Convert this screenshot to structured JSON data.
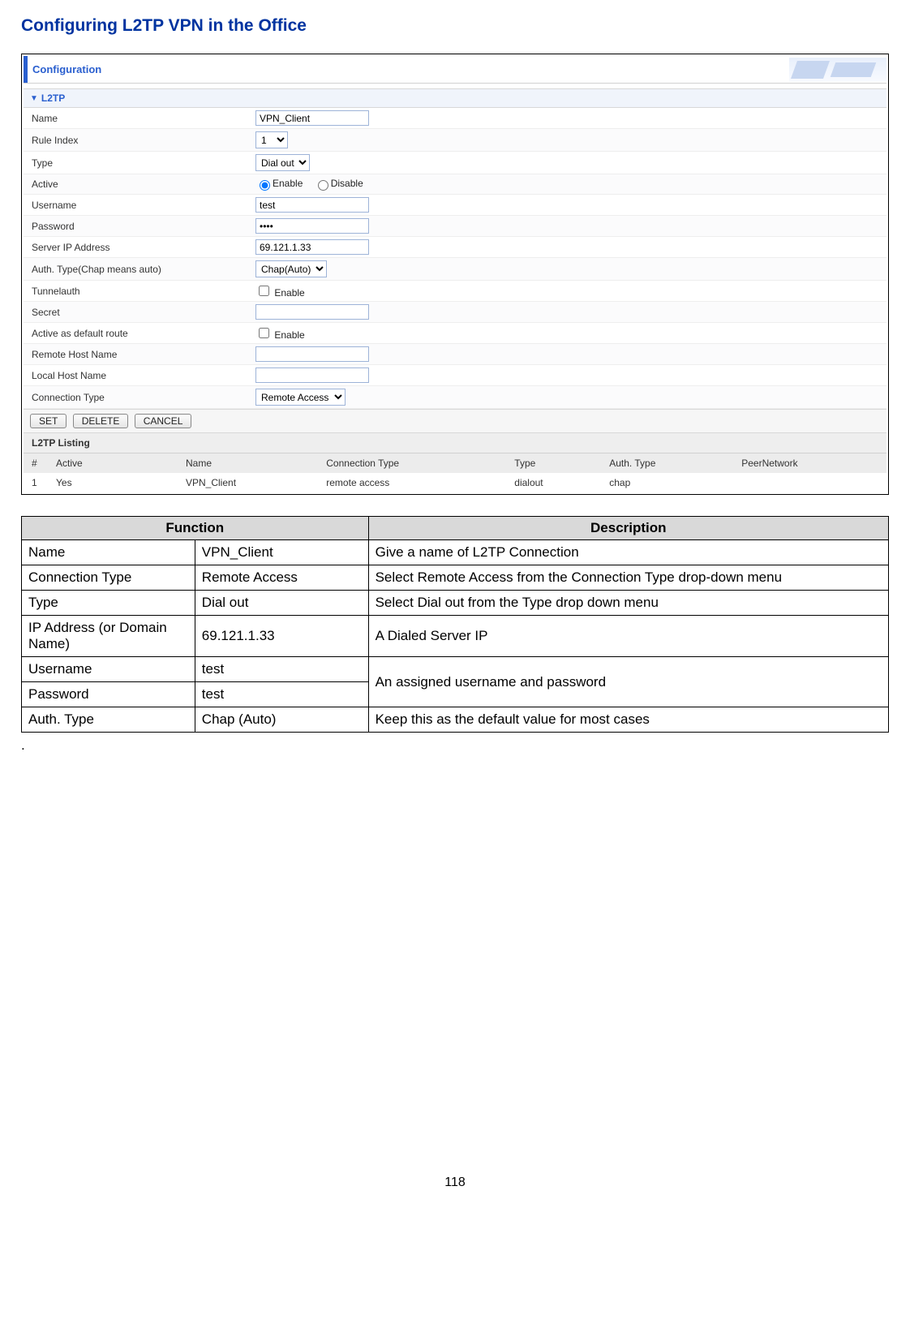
{
  "page_title": "Configuring L2TP VPN in the Office",
  "config_title": "Configuration",
  "section_title": "L2TP",
  "form": {
    "name_label": "Name",
    "name_value": "VPN_Client",
    "rule_index_label": "Rule Index",
    "rule_index_value": "1",
    "type_label": "Type",
    "type_value": "Dial out",
    "active_label": "Active",
    "active_enable": "Enable",
    "active_disable": "Disable",
    "username_label": "Username",
    "username_value": "test",
    "password_label": "Password",
    "password_value": "••••",
    "server_ip_label": "Server IP Address",
    "server_ip_value": "69.121.1.33",
    "auth_type_label": "Auth. Type(Chap means auto)",
    "auth_type_value": "Chap(Auto)",
    "tunnelauth_label": "Tunnelauth",
    "tunnelauth_enable": "Enable",
    "secret_label": "Secret",
    "secret_value": "",
    "default_route_label": "Active as default route",
    "default_route_enable": "Enable",
    "remote_host_label": "Remote Host Name",
    "remote_host_value": "",
    "local_host_label": "Local Host Name",
    "local_host_value": "",
    "conn_type_label": "Connection Type",
    "conn_type_value": "Remote Access"
  },
  "buttons": {
    "set": "SET",
    "delete": "DELETE",
    "cancel": "CANCEL"
  },
  "listing": {
    "title": "L2TP Listing",
    "headers": {
      "num": "#",
      "active": "Active",
      "name": "Name",
      "conn_type": "Connection Type",
      "type": "Type",
      "auth": "Auth. Type",
      "peer": "PeerNetwork"
    },
    "row": {
      "num": "1",
      "active": "Yes",
      "name": "VPN_Client",
      "conn_type": "remote access",
      "type": "dialout",
      "auth": "chap",
      "peer": ""
    }
  },
  "func_table": {
    "th_func": "Function",
    "th_desc": "Description",
    "rows": {
      "r1": {
        "a": "Name",
        "b": "VPN_Client",
        "c": "Give a name of L2TP Connection"
      },
      "r2": {
        "a": "Connection Type",
        "b": "Remote Access",
        "c": "Select Remote Access from the Connection Type drop-down menu"
      },
      "r3": {
        "a": "Type",
        "b": "Dial out",
        "c": "Select Dial out from the Type drop down menu"
      },
      "r4": {
        "a": "IP Address (or Domain Name)",
        "b": "69.121.1.33",
        "c": "A Dialed Server IP"
      },
      "r5": {
        "a": "Username",
        "b": "test",
        "c": "An assigned username and password"
      },
      "r6": {
        "a": "Password",
        "b": "test"
      },
      "r7": {
        "a": "Auth. Type",
        "b": "Chap (Auto)",
        "c": "Keep this as the default value for most cases"
      }
    }
  },
  "dot": ".",
  "page_number": "118"
}
